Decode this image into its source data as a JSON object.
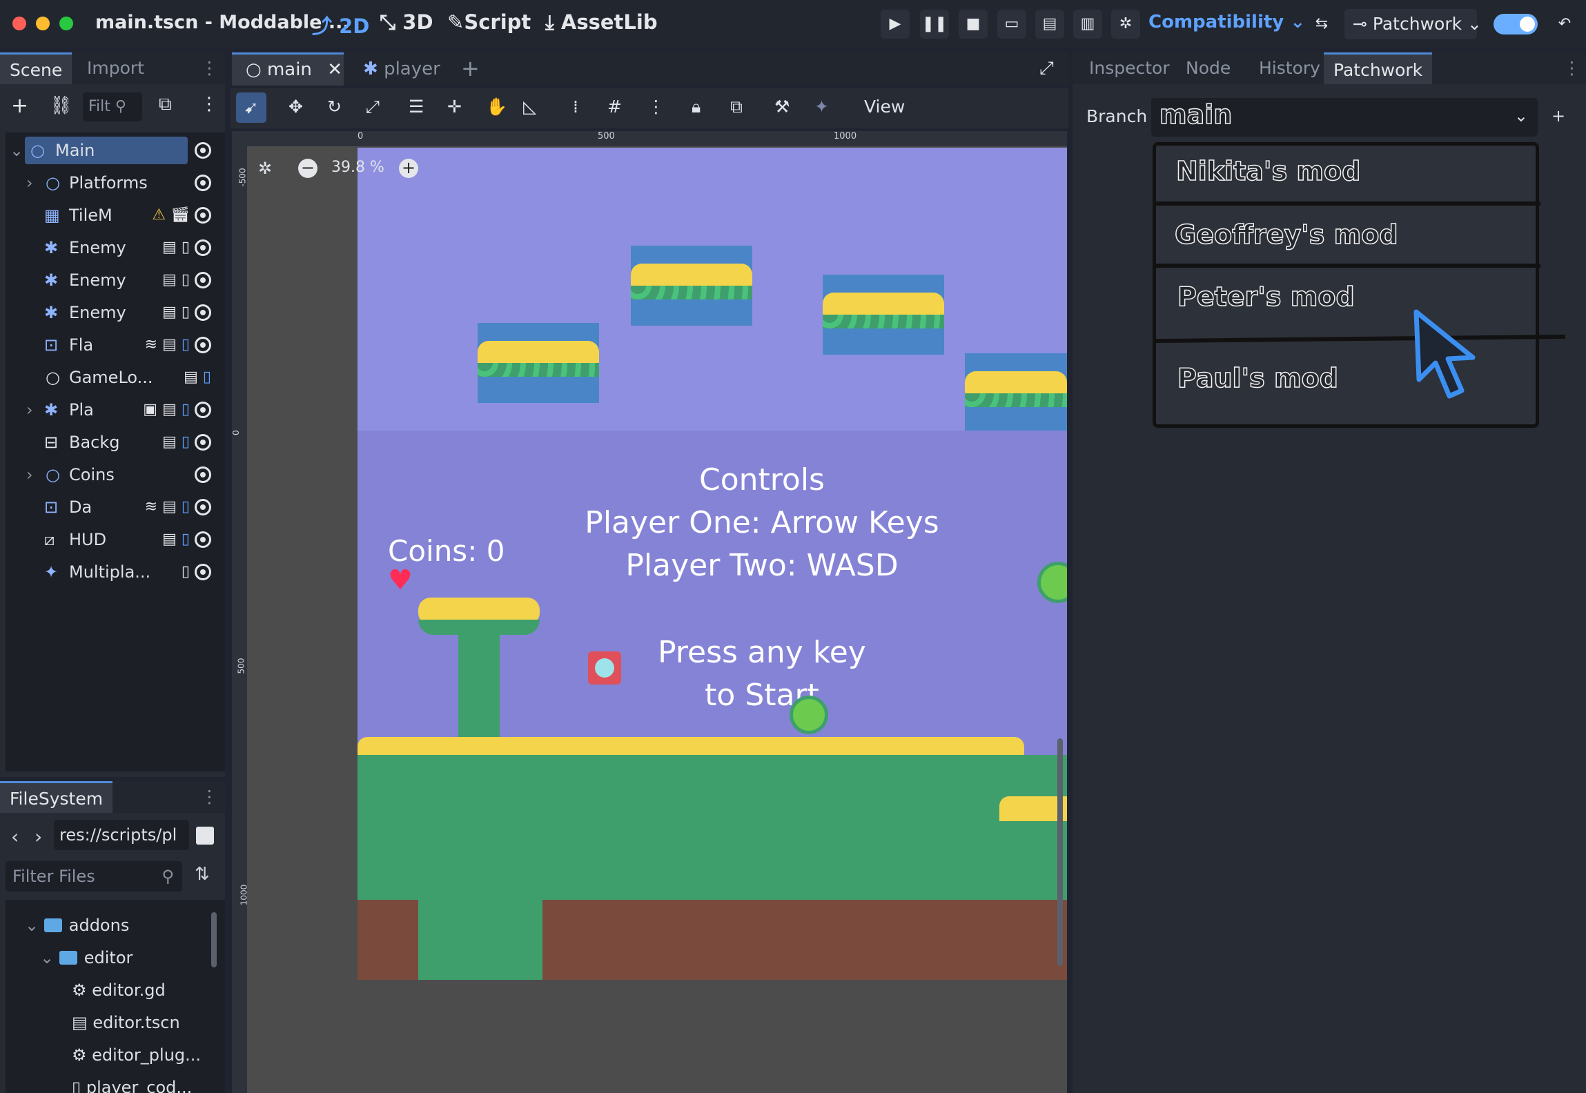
{
  "window": {
    "title": "main.tscn - Moddable ..."
  },
  "modes": {
    "m2d": "2D",
    "m3d": "3D",
    "script": "Script",
    "assetlib": "AssetLib"
  },
  "renderer": "Compatibility",
  "vcs": {
    "label": "Patchwork"
  },
  "scene_dock": {
    "tabs": [
      "Scene",
      "Import"
    ],
    "filter_placeholder": "Filt",
    "nodes": [
      {
        "name": "Main"
      },
      {
        "name": "Platforms"
      },
      {
        "name": "TileM"
      },
      {
        "name": "Enemy"
      },
      {
        "name": "Enemy"
      },
      {
        "name": "Enemy"
      },
      {
        "name": "Fla"
      },
      {
        "name": "GameLo..."
      },
      {
        "name": "Pla"
      },
      {
        "name": "Backg"
      },
      {
        "name": "Coins"
      },
      {
        "name": "Da"
      },
      {
        "name": "HUD"
      },
      {
        "name": "Multipla..."
      }
    ]
  },
  "filesystem": {
    "tab": "FileSystem",
    "path": "res://scripts/pl",
    "filter_placeholder": "Filter Files",
    "items": [
      {
        "name": "addons"
      },
      {
        "name": "editor"
      },
      {
        "name": "editor.gd"
      },
      {
        "name": "editor.tscn"
      },
      {
        "name": "editor_plug..."
      },
      {
        "name": "player_cod..."
      }
    ]
  },
  "editor_tabs": [
    "main",
    "player"
  ],
  "toolbar": {
    "view_label": "View",
    "zoom": "39.8 %"
  },
  "rulers": {
    "h": [
      "0",
      "500",
      "1000"
    ],
    "v": [
      "-500",
      "0",
      "500",
      "1000"
    ]
  },
  "game": {
    "coins_label": "Coins: 0",
    "controls_title": "Controls",
    "controls_p1": "Player One: Arrow Keys",
    "controls_p2": "Player Two: WASD",
    "start_line1": "Press any key",
    "start_line2": "to Start"
  },
  "inspector_dock": {
    "tabs": [
      "Inspector",
      "Node",
      "History",
      "Patchwork"
    ]
  },
  "branch": {
    "label": "Branch",
    "current": "main",
    "options": [
      "Nikita's mod",
      "Geoffrey's mod",
      "Peter's mod",
      "Paul's mod"
    ]
  },
  "colors": {
    "accent": "#5ea2ff",
    "bg": "#1f2430",
    "sky": "#8e8fe0",
    "grass": "#3f9f6c"
  }
}
